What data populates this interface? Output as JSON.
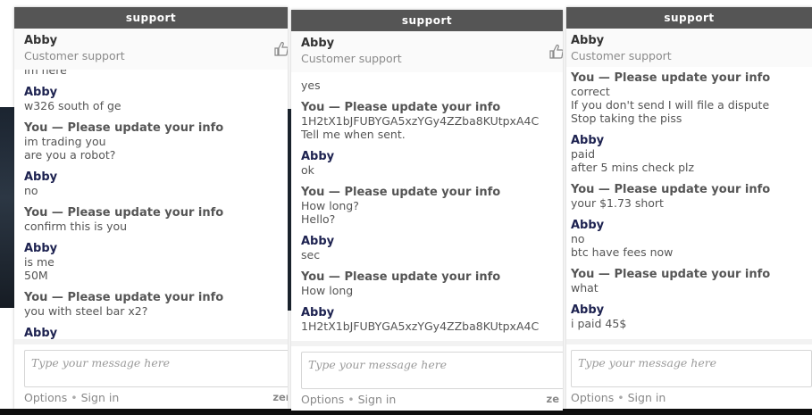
{
  "panels": [
    {
      "title": "support",
      "agent_name": "Abby",
      "agent_role": "Customer support",
      "messages": [
        {
          "sender": "",
          "lines": [
            "im here"
          ]
        },
        {
          "sender": "Abby",
          "lines": [
            "w326 south of ge"
          ]
        },
        {
          "sender": "You — Please update your info",
          "lines": [
            "im trading you",
            "are you a robot?"
          ]
        },
        {
          "sender": "Abby",
          "lines": [
            "no"
          ]
        },
        {
          "sender": "You — Please update your info",
          "lines": [
            "confirm this is you"
          ]
        },
        {
          "sender": "Abby",
          "lines": [
            "is me",
            "50M"
          ]
        },
        {
          "sender": "You — Please update your info",
          "lines": [
            "you with steel bar x2?"
          ]
        },
        {
          "sender": "Abby",
          "lines": []
        }
      ],
      "placeholder": "Type your message here",
      "options_label": "Options",
      "signin_label": "Sign in",
      "brand": "zen"
    },
    {
      "title": "support",
      "agent_name": "Abby",
      "agent_role": "Customer support",
      "messages": [
        {
          "sender": "",
          "lines": [
            "yes"
          ]
        },
        {
          "sender": "You — Please update your info",
          "lines": [
            "1H2tX1bJFUBYGA5xzYGy4ZZba8KUtpxA4C",
            "Tell me when sent."
          ]
        },
        {
          "sender": "Abby",
          "lines": [
            "ok"
          ]
        },
        {
          "sender": "You — Please update your info",
          "lines": [
            "How long?",
            "Hello?"
          ]
        },
        {
          "sender": "Abby",
          "lines": [
            "sec"
          ]
        },
        {
          "sender": "You — Please update your info",
          "lines": [
            "How long"
          ]
        },
        {
          "sender": "Abby",
          "lines": [
            "1H2tX1bJFUBYGA5xzYGy4ZZba8KUtpxA4C"
          ]
        }
      ],
      "placeholder": "Type your message here",
      "options_label": "Options",
      "signin_label": "Sign in",
      "brand": "ze"
    },
    {
      "title": "support",
      "agent_name": "Abby",
      "agent_role": "Customer support",
      "messages": [
        {
          "sender": "You — Please update your info",
          "lines": [
            "correct",
            "If you don't send I will file a dispute",
            "Stop taking the piss"
          ]
        },
        {
          "sender": "Abby",
          "lines": [
            "paid",
            "after 5 mins check plz"
          ]
        },
        {
          "sender": "You — Please update your info",
          "lines": [
            "your $1.73 short"
          ]
        },
        {
          "sender": "Abby",
          "lines": [
            "no",
            "btc have fees now"
          ]
        },
        {
          "sender": "You — Please update your info",
          "lines": [
            "what"
          ]
        },
        {
          "sender": "Abby",
          "lines": [
            "i paid 45$"
          ]
        }
      ],
      "placeholder": "Type your message here",
      "options_label": "Options",
      "signin_label": "Sign in",
      "brand": ""
    }
  ]
}
